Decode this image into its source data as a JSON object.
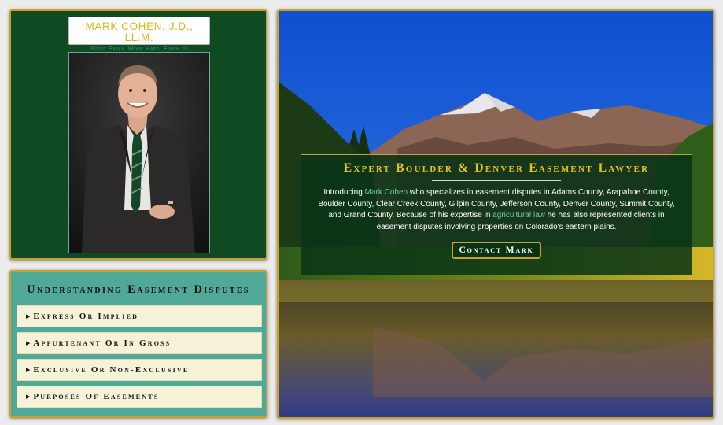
{
  "logo": {
    "name": "MARK COHEN, J.D., LL.M.",
    "tagline": "Start Early. Work Hard. Finish. ®"
  },
  "easements": {
    "title": "Understanding Easement Disputes",
    "items": [
      {
        "label": "Express Or Implied"
      },
      {
        "label": "Appurtenant Or In Gross"
      },
      {
        "label": "Exclusive Or Non-Exclusive"
      },
      {
        "label": "Purposes Of Easements"
      }
    ]
  },
  "hero": {
    "title": "Expert Boulder & Denver Easement Lawyer",
    "intro_before": "Introducing ",
    "intro_link1": "Mark Cohen",
    "intro_middle": " who specializes in easement disputes in Adams County, Arapahoe County, Boulder County, Clear Creek County, Gilpin County, Jefferson County, Denver County, Summit County, and Grand County. Because of his expertise in ",
    "intro_link2": "agricultural law",
    "intro_after": " he has also represented clients in easement disputes involving properties on Colorado's eastern plains.",
    "button": "Contact Mark"
  },
  "colors": {
    "green_panel": "#0f4a22",
    "gold_border": "#c9a227",
    "teal_panel": "#4fa898",
    "cream_button": "#f6f2d8",
    "title_gold": "#e6c21e",
    "link_teal": "#6fc8b3"
  },
  "icons": {
    "list_marker": "triangle-right-icon"
  }
}
